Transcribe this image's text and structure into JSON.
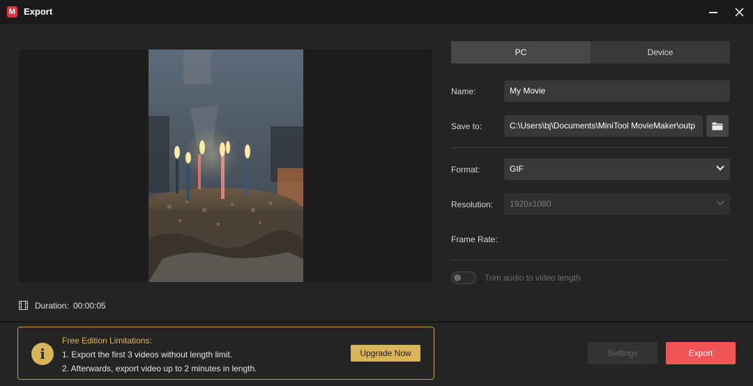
{
  "window": {
    "title": "Export",
    "logo_letter": "M"
  },
  "preview": {
    "duration_label": "Duration:",
    "duration_value": "00:00:05"
  },
  "tabs": [
    {
      "label": "PC"
    },
    {
      "label": "Device"
    }
  ],
  "form": {
    "name_label": "Name:",
    "name_value": "My Movie",
    "save_to_label": "Save to:",
    "save_to_value": "C:\\Users\\bj\\Documents\\MiniTool MovieMaker\\outp",
    "format_label": "Format:",
    "format_value": "GIF",
    "resolution_label": "Resolution:",
    "resolution_value": "1920x1080",
    "frame_rate_label": "Frame Rate:",
    "trim_audio_label": "Trim audio to video length",
    "trim_audio_on": false
  },
  "notice": {
    "title": "Free Edition Limitations:",
    "line1": "1. Export the first 3 videos without length limit.",
    "line2": "2. Afterwards, export video up to 2 minutes in length.",
    "upgrade_label": "Upgrade Now"
  },
  "buttons": {
    "settings_label": "Settings",
    "export_label": "Export"
  },
  "colors": {
    "accent": "#f05454",
    "notice_gold": "#d9b45a",
    "background": "#242424"
  },
  "icons": {
    "logo": "app-logo-icon",
    "minimize": "minimize-icon",
    "close": "close-icon",
    "film": "film-icon",
    "folder": "folder-icon",
    "chevron": "chevron-down-icon",
    "info": "info-icon"
  }
}
